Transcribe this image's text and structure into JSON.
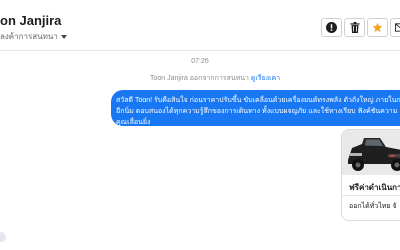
{
  "header": {
    "contact_name": "on Janjira",
    "contact_subtitle": "ลงค้าการสนทนา",
    "actions": [
      {
        "id": "info",
        "icon": "info-icon"
      },
      {
        "id": "delete",
        "icon": "trash-icon"
      },
      {
        "id": "star",
        "icon": "star-icon",
        "color": "#f7a21b"
      },
      {
        "id": "mail",
        "icon": "mail-icon"
      }
    ]
  },
  "conversation": {
    "timestamp": "07:26",
    "system_message": {
      "text": "Toon Janjira ออกจากการสนทนา ",
      "link": "ดูเรียงเคา"
    },
    "outgoing_message": {
      "color": "#1877f2",
      "lines": [
        "สวัสดี Toon! รับคือสินใจ ก่อนราคาปรับขึ้น ขับเคลื่อนด้วยเครื่องยนต์ทรงพลัง ตัวถังใหญ่ ภายในก",
        "อีกนิ่ม ตอบสนองได้ทุกความรู้สึกของการเดินทาง ทั้งแบบผจญภัย และใช้ทางเรียบ ฟังค์ชันความ",
        "คุณเลื่อนยิ่ง"
      ]
    },
    "card": {
      "title": "ฟรีค่าดำเนินการ",
      "subtitle": "ออกได้ทั่วไทย จั"
    }
  }
}
